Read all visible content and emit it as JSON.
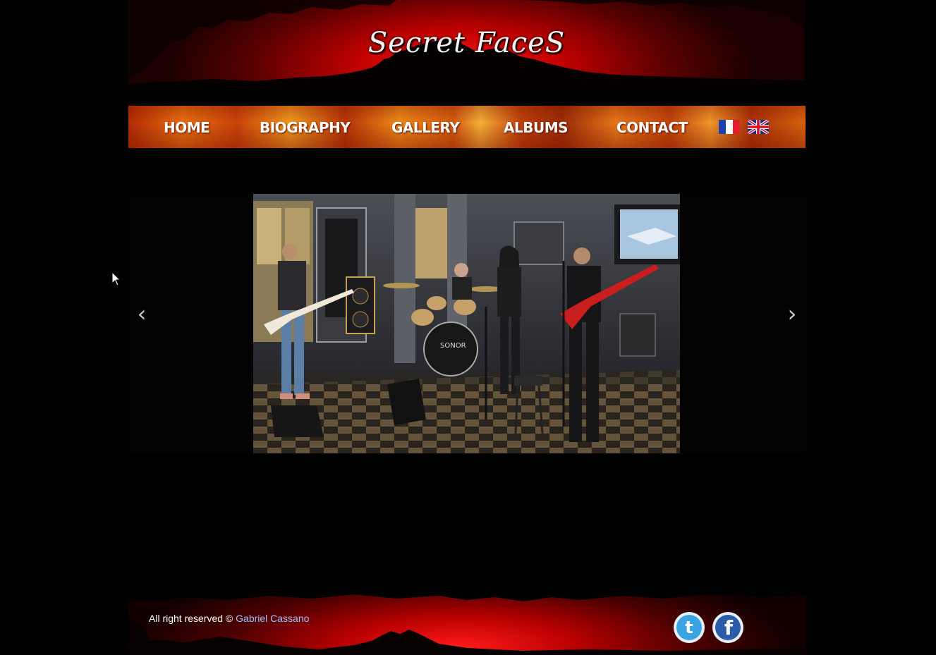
{
  "header": {
    "logo_text": "Secret FaceS"
  },
  "nav": {
    "items": [
      {
        "label": "HOME"
      },
      {
        "label": "BIOGRAPHY"
      },
      {
        "label": "GALLERY"
      },
      {
        "label": "ALBUMS"
      },
      {
        "label": "CONTACT"
      }
    ],
    "languages": [
      {
        "code": "fr",
        "icon": "flag-france-icon"
      },
      {
        "code": "en",
        "icon": "flag-uk-icon"
      }
    ]
  },
  "slider": {
    "prev_label": "‹",
    "next_label": "›",
    "image_icon": "band-photo"
  },
  "footer": {
    "copyright_prefix": "All right reserved ©",
    "author_link": "Gabriel Cassano",
    "social": [
      {
        "name": "twitter",
        "icon": "twitter-icon",
        "letter": "t"
      },
      {
        "name": "facebook",
        "icon": "facebook-icon",
        "letter": "f"
      }
    ]
  },
  "colors": {
    "accent_red": "#c00000",
    "link_blue": "#9cc0ff",
    "social_blue": "#1e88e5"
  }
}
